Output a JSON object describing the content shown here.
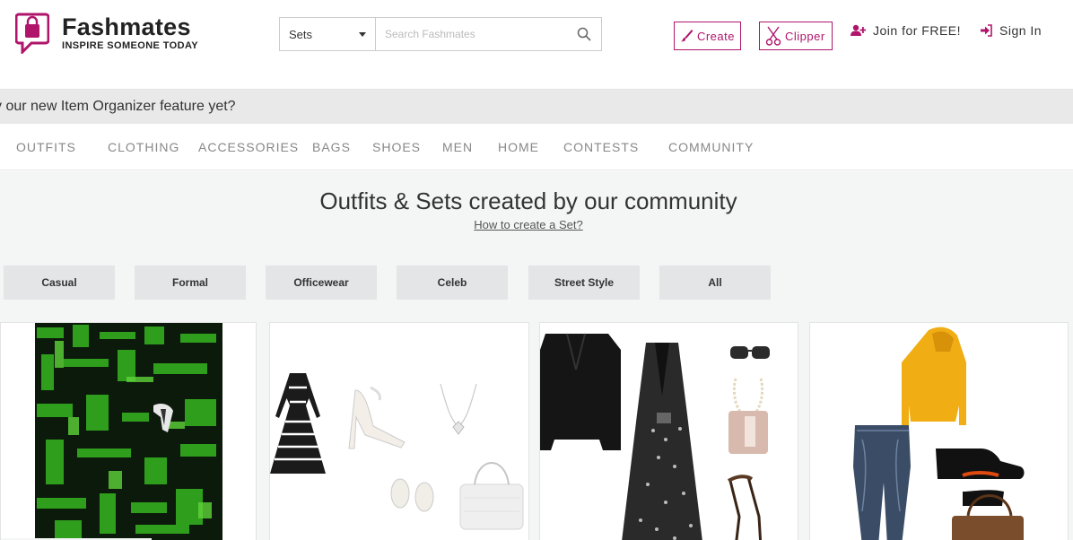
{
  "header": {
    "brand": "Fashmates",
    "tagline": "INSPIRE SOMEONE TODAY",
    "search": {
      "selected": "Sets",
      "placeholder": "Search Fashmates"
    },
    "create_label": "Create",
    "clipper_label": "Clipper",
    "join_label": "Join for FREE!",
    "signin_label": "Sign In"
  },
  "announcement": "y our new Item Organizer feature yet?",
  "nav": [
    "OUTFITS",
    "CLOTHING",
    "ACCESSORIES",
    "BAGS",
    "SHOES",
    "MEN",
    "HOME",
    "CONTESTS",
    "COMMUNITY"
  ],
  "main": {
    "headline": "Outfits & Sets created by our community",
    "howto_link": "How to create a Set?"
  },
  "filters": [
    "Casual",
    "Formal",
    "Officewear",
    "Celeb",
    "Street Style",
    "All"
  ],
  "sets": [
    "set-green-abstract",
    "set-striped-dress",
    "set-black-dress",
    "set-yellow-hoodie"
  ],
  "colors": {
    "brand": "#b0156b",
    "announcement_bg": "#e9e9e9",
    "main_bg": "#f4f5f5",
    "filter_bg": "#e3e5e6"
  }
}
